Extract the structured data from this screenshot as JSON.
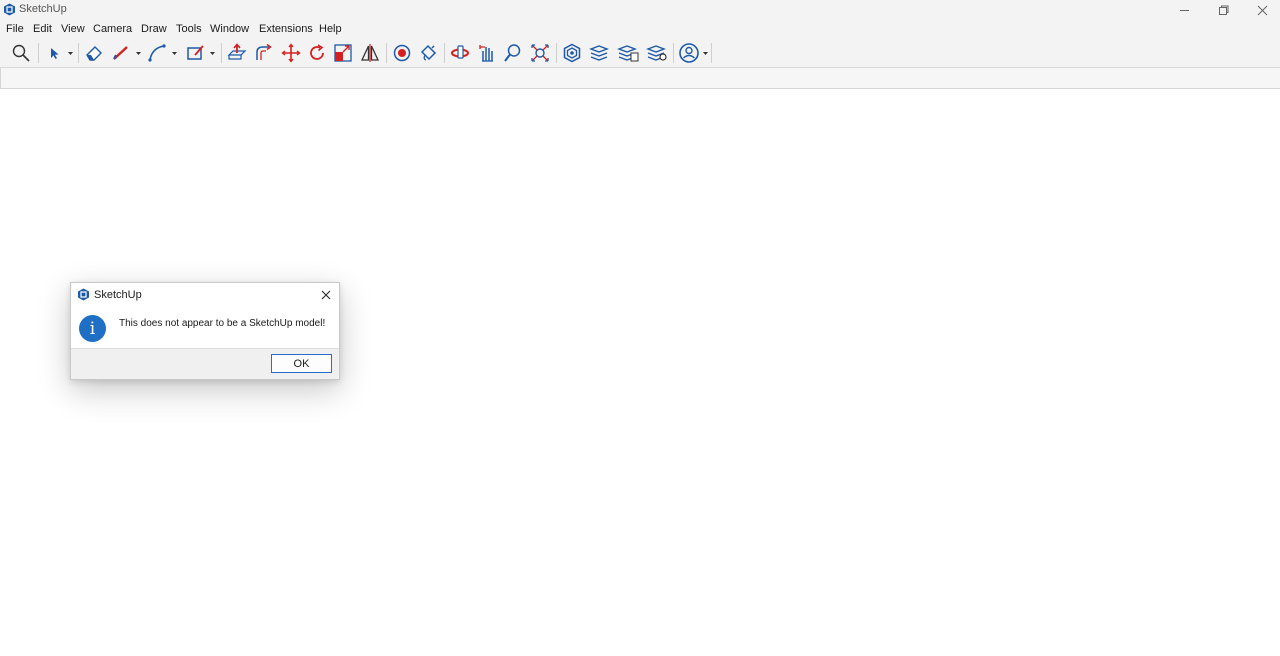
{
  "window": {
    "title": "SketchUp",
    "controls": [
      "minimize",
      "maximize",
      "close"
    ]
  },
  "menubar": {
    "items": [
      "File",
      "Edit",
      "View",
      "Camera",
      "Draw",
      "Tools",
      "Window",
      "Extensions",
      "Help"
    ]
  },
  "toolbar": {
    "tools": [
      "search-icon",
      "select-icon",
      "eraser-icon",
      "pencil-line-icon",
      "arc-icon",
      "shape-icon",
      "push-pull-icon",
      "follow-me-icon",
      "move-icon",
      "rotate-icon",
      "scale-icon",
      "flip-icon",
      "offset-icon",
      "paint-bucket-icon",
      "orbit-icon",
      "pan-icon",
      "zoom-icon",
      "zoom-extents-icon",
      "3d-warehouse-icon",
      "layers-icon",
      "outliner-icon",
      "scenes-icon",
      "account-icon"
    ]
  },
  "dialog": {
    "title": "SketchUp",
    "message": "This does not appear to be a SketchUp model!",
    "ok_label": "OK",
    "icon": "info-icon",
    "info_glyph": "i"
  },
  "colors": {
    "accent": "#1f6fc5",
    "tool_blue": "#1e5aa8",
    "tool_red": "#d42020"
  }
}
